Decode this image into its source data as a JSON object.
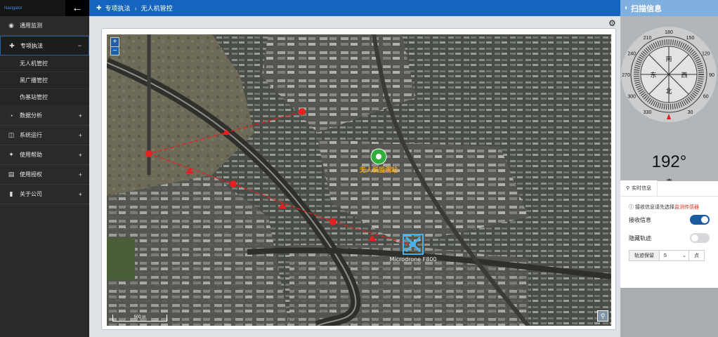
{
  "sidebar": {
    "brand": "Navigator",
    "back_icon": "arrow-left-icon",
    "items": [
      {
        "label": "通用监测",
        "icon": "map-pin-icon",
        "sign": ""
      },
      {
        "label": "专项执法",
        "icon": "crosshair-icon",
        "sign": "−",
        "active": true
      },
      {
        "label": "数据分析",
        "icon": "pie-chart-icon",
        "sign": "+"
      },
      {
        "label": "系统运行",
        "icon": "columns-icon",
        "sign": "+"
      },
      {
        "label": "使用帮助",
        "icon": "magic-wand-icon",
        "sign": "+"
      },
      {
        "label": "使用授权",
        "icon": "id-card-icon",
        "sign": "+"
      },
      {
        "label": "关于公司",
        "icon": "book-icon",
        "sign": "+"
      }
    ],
    "submenu": [
      {
        "label": "无人机管控"
      },
      {
        "label": "黑广播管控"
      },
      {
        "label": "伪基站管控"
      }
    ]
  },
  "topbar": {
    "section": "专项执法",
    "page": "无人机管控"
  },
  "map": {
    "zoom_in": "+",
    "zoom_out": "−",
    "scale_label": "500 m",
    "station_label": "无人机监测站",
    "drone_label": "Microdrone F800"
  },
  "right_panel": {
    "title": "扫描信息",
    "heading_value": "192°",
    "heading_dir": "南",
    "compass": {
      "degrees": [
        "180",
        "210",
        "240",
        "270",
        "300",
        "330",
        "0",
        "30",
        "60",
        "90",
        "120",
        "150"
      ],
      "cardinals": {
        "south": "南",
        "west": "西",
        "north": "北",
        "east": "东"
      }
    },
    "tab_label": "实时信息",
    "note_prefix": "接收信息请先选择",
    "note_link": "监测传感器",
    "receive_label": "接收信息",
    "receive_on": true,
    "hide_track_label": "隐藏轨迹",
    "hide_track_on": false,
    "track_keep_label": "轨迹保留",
    "track_keep_value": "5",
    "track_keep_unit": "点"
  }
}
